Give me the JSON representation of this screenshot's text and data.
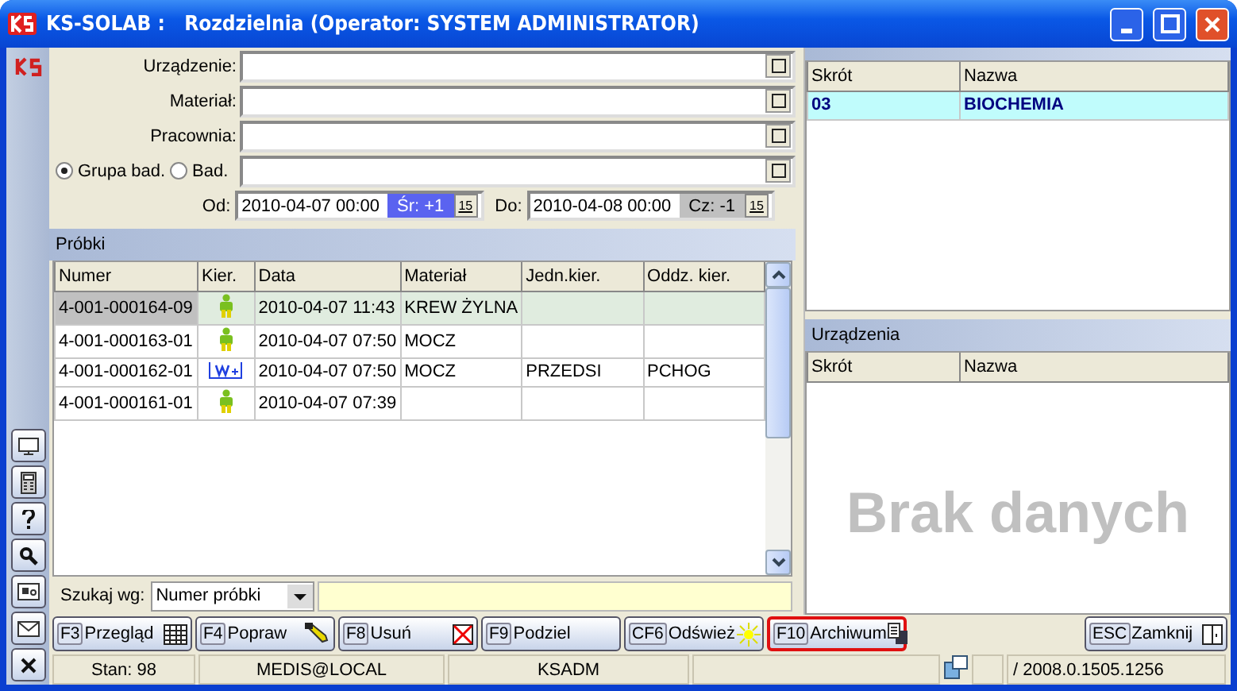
{
  "window": {
    "title": "KS-SOLAB :   Rozdzielnia (Operator: SYSTEM ADMINISTRATOR)"
  },
  "filters": [
    {
      "label": "Urządzenie:"
    },
    {
      "label": "Materiał:"
    },
    {
      "label": "Pracownia:"
    }
  ],
  "group_filter": {
    "options": [
      {
        "label": "Grupa bad.",
        "selected": true
      },
      {
        "label": "Bad.",
        "selected": false
      }
    ]
  },
  "date_range": {
    "from_label": "Od:",
    "from": "2010-04-07 00:00",
    "from_day": "Śr: +1",
    "from_day_highlighted": true,
    "from_calendar": "15",
    "to_label": "Do:",
    "to": "2010-04-08 00:00",
    "to_day": "Cz: -1",
    "to_day_highlighted": false,
    "to_calendar": "15"
  },
  "samples": {
    "title": "Próbki",
    "columns": [
      "Numer",
      "Kier.",
      "Data",
      "Materiał",
      "Jedn.kier.",
      "Oddz. kier."
    ],
    "rows": [
      {
        "numer": "4-001-000164-09",
        "kind": "person",
        "data": "2010-04-07 11:43",
        "material": "KREW ŻYLNA",
        "selected": true
      },
      {
        "numer": "4-001-000163-01",
        "kind": "person",
        "data": "2010-04-07 07:50",
        "material": "MOCZ",
        "selected": false
      },
      {
        "numer": "4-001-000162-01",
        "kind": "ward",
        "data": "2010-04-07 07:50",
        "material": "MOCZ",
        "jedn": "PRZEDSI",
        "oddz": "PCHOG",
        "selected": false
      },
      {
        "numer": "4-001-000161-01",
        "kind": "person",
        "data": "2010-04-07 07:39",
        "selected": false
      }
    ]
  },
  "search": {
    "label": "Szukaj wg:",
    "by": "Numer próbki"
  },
  "labs": {
    "columns": [
      "Skrót",
      "Nazwa"
    ],
    "rows": [
      {
        "code": "03",
        "name": "BIOCHEMIA",
        "selected": true
      }
    ]
  },
  "devices": {
    "title": "Urządzenia",
    "columns": [
      "Skrót",
      "Nazwa"
    ],
    "empty_text": "Brak danych"
  },
  "buttons": [
    {
      "key": "F3",
      "label": "Przegląd",
      "kind": "table",
      "highlighted": false
    },
    {
      "key": "F4",
      "label": "Popraw",
      "kind": "pen",
      "highlighted": false
    },
    {
      "key": "F8",
      "label": "Usuń",
      "kind": "delete",
      "highlighted": false
    },
    {
      "key": "F9",
      "label": "Podziel",
      "kind": "plain",
      "highlighted": false
    },
    {
      "key": "CF6",
      "label": "Odśwież",
      "kind": "sun",
      "highlighted": false
    },
    {
      "key": "F10",
      "label": "Archiwum",
      "kind": "copy",
      "highlighted": true
    }
  ],
  "close_button": {
    "key": "ESC",
    "label": "Zamknij"
  },
  "status_bar": {
    "count": "Stan: 98",
    "database": "MEDIS@LOCAL",
    "user": "KSADM",
    "version": "/ 2008.0.1505.1256"
  }
}
